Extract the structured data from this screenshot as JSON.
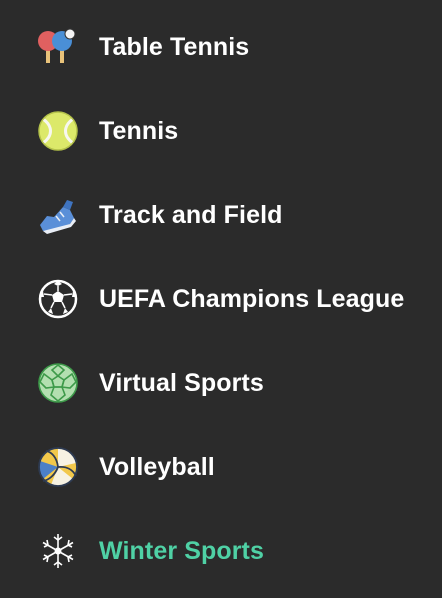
{
  "sports_list": {
    "items": [
      {
        "label": "Table Tennis",
        "icon": "table-tennis-icon",
        "active": false
      },
      {
        "label": "Tennis",
        "icon": "tennis-ball-icon",
        "active": false
      },
      {
        "label": "Track and Field",
        "icon": "running-shoe-icon",
        "active": false
      },
      {
        "label": "UEFA Champions League",
        "icon": "soccer-ball-icon",
        "active": false
      },
      {
        "label": "Virtual Sports",
        "icon": "virtual-ball-icon",
        "active": false
      },
      {
        "label": "Volleyball",
        "icon": "volleyball-icon",
        "active": false
      },
      {
        "label": "Winter Sports",
        "icon": "snowflake-icon",
        "active": true
      }
    ]
  },
  "colors": {
    "background": "#2b2b2b",
    "label": "#ffffff",
    "active_label": "#4fd1a5"
  }
}
